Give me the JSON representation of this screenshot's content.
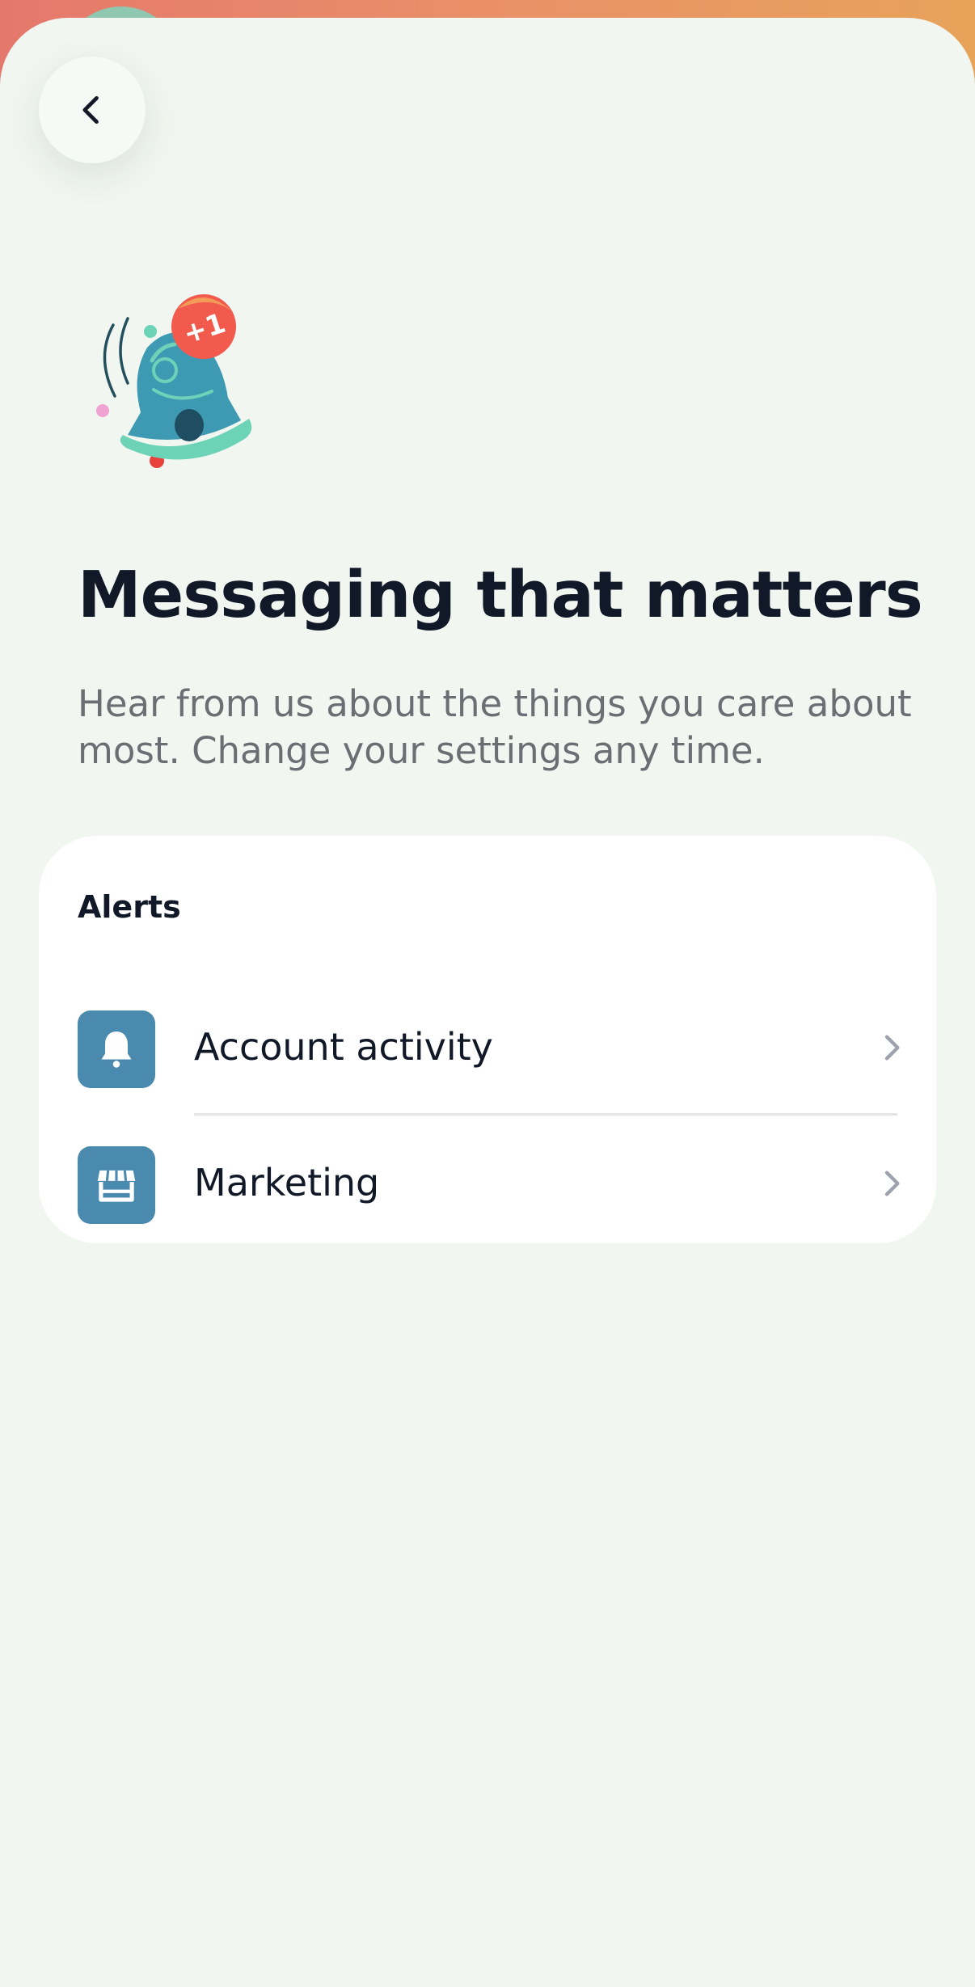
{
  "header": {
    "back_icon": "chevron-left-icon"
  },
  "hero": {
    "illustration": "bell-notification-icon",
    "badge_text": "+1",
    "title": "Messaging that matters",
    "subtitle": "Hear from us about the things you care about most. Change your settings any time."
  },
  "alerts": {
    "heading": "Alerts",
    "items": [
      {
        "label": "Account activity",
        "icon": "bell-icon"
      },
      {
        "label": "Marketing",
        "icon": "storefront-icon"
      }
    ]
  },
  "colors": {
    "background": "#f1f6f1",
    "card": "#ffffff",
    "icon_tile": "#4a8aaf",
    "title_text": "#111827",
    "subtitle_text": "#6b6f73",
    "header_gradient_start": "#e5786c",
    "header_gradient_end": "#e7a35a"
  }
}
